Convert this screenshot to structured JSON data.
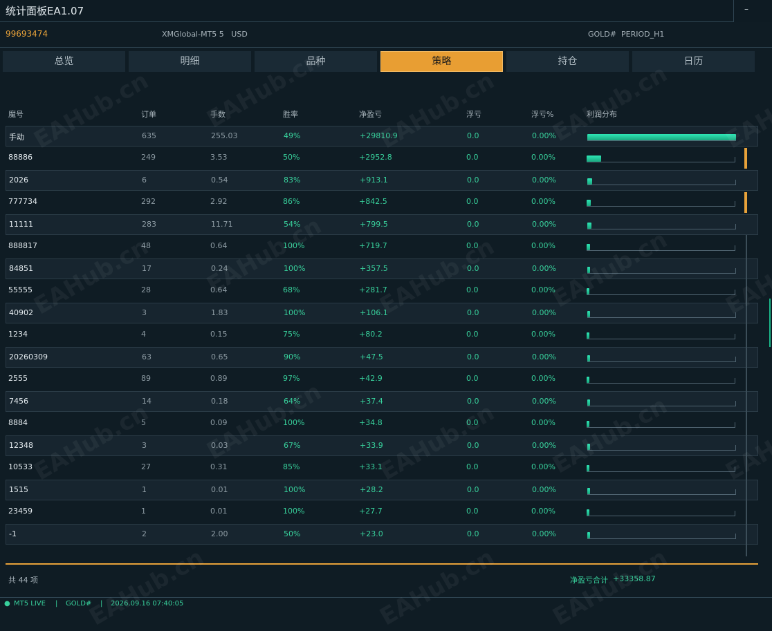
{
  "window": {
    "title": "统计面板EA1.07",
    "minimize_label": "–"
  },
  "info": {
    "account": "99693474",
    "server": "XMGlobal-MT5 5",
    "currency": "USD",
    "symbol": "GOLD#",
    "period": "PERIOD_H1"
  },
  "tabs": [
    {
      "label": "总览"
    },
    {
      "label": "明细"
    },
    {
      "label": "品种"
    },
    {
      "label": "策略",
      "active": true
    },
    {
      "label": "持仓"
    },
    {
      "label": "日历"
    }
  ],
  "table": {
    "columns": [
      "魔号",
      "订单",
      "手数",
      "胜率",
      "净盈亏",
      "浮亏",
      "浮亏%",
      "利润分布"
    ],
    "rows": [
      {
        "magic": "手动",
        "orders": "635",
        "lots": "255.03",
        "winrate": "49%",
        "net": "+29810.9",
        "float": "0.0",
        "float_pct": "0.00%",
        "share": 1.0,
        "accent": false
      },
      {
        "magic": "88886",
        "orders": "249",
        "lots": "3.53",
        "winrate": "50%",
        "net": "+2952.8",
        "float": "0.0",
        "float_pct": "0.00%",
        "share": 0.099,
        "accent": true
      },
      {
        "magic": "2026",
        "orders": "6",
        "lots": "0.54",
        "winrate": "83%",
        "net": "+913.1",
        "float": "0.0",
        "float_pct": "0.00%",
        "share": 0.031,
        "accent": false
      },
      {
        "magic": "777734",
        "orders": "292",
        "lots": "2.92",
        "winrate": "86%",
        "net": "+842.5",
        "float": "0.0",
        "float_pct": "0.00%",
        "share": 0.028,
        "accent": true
      },
      {
        "magic": "11111",
        "orders": "283",
        "lots": "11.71",
        "winrate": "54%",
        "net": "+799.5",
        "float": "0.0",
        "float_pct": "0.00%",
        "share": 0.027,
        "accent": false
      },
      {
        "magic": "888817",
        "orders": "48",
        "lots": "0.64",
        "winrate": "100%",
        "net": "+719.7",
        "float": "0.0",
        "float_pct": "0.00%",
        "share": 0.024,
        "accent": false
      },
      {
        "magic": "84851",
        "orders": "17",
        "lots": "0.24",
        "winrate": "100%",
        "net": "+357.5",
        "float": "0.0",
        "float_pct": "0.00%",
        "share": 0.012,
        "accent": false
      },
      {
        "magic": "55555",
        "orders": "28",
        "lots": "0.64",
        "winrate": "68%",
        "net": "+281.7",
        "float": "0.0",
        "float_pct": "0.00%",
        "share": 0.0095,
        "accent": false
      },
      {
        "magic": "40902",
        "orders": "3",
        "lots": "1.83",
        "winrate": "100%",
        "net": "+106.1",
        "float": "0.0",
        "float_pct": "0.00%",
        "share": 0.0036,
        "accent": false
      },
      {
        "magic": "1234",
        "orders": "4",
        "lots": "0.15",
        "winrate": "75%",
        "net": "+80.2",
        "float": "0.0",
        "float_pct": "0.00%",
        "share": 0.0027,
        "accent": false
      },
      {
        "magic": "20260309",
        "orders": "63",
        "lots": "0.65",
        "winrate": "90%",
        "net": "+47.5",
        "float": "0.0",
        "float_pct": "0.00%",
        "share": 0.0016,
        "accent": false
      },
      {
        "magic": "2555",
        "orders": "89",
        "lots": "0.89",
        "winrate": "97%",
        "net": "+42.9",
        "float": "0.0",
        "float_pct": "0.00%",
        "share": 0.0014,
        "accent": false
      },
      {
        "magic": "7456",
        "orders": "14",
        "lots": "0.18",
        "winrate": "64%",
        "net": "+37.4",
        "float": "0.0",
        "float_pct": "0.00%",
        "share": 0.0013,
        "accent": false
      },
      {
        "magic": "8884",
        "orders": "5",
        "lots": "0.09",
        "winrate": "100%",
        "net": "+34.8",
        "float": "0.0",
        "float_pct": "0.00%",
        "share": 0.0012,
        "accent": false
      },
      {
        "magic": "12348",
        "orders": "3",
        "lots": "0.03",
        "winrate": "67%",
        "net": "+33.9",
        "float": "0.0",
        "float_pct": "0.00%",
        "share": 0.0011,
        "accent": false
      },
      {
        "magic": "10533",
        "orders": "27",
        "lots": "0.31",
        "winrate": "85%",
        "net": "+33.1",
        "float": "0.0",
        "float_pct": "0.00%",
        "share": 0.0011,
        "accent": false
      },
      {
        "magic": "1515",
        "orders": "1",
        "lots": "0.01",
        "winrate": "100%",
        "net": "+28.2",
        "float": "0.0",
        "float_pct": "0.00%",
        "share": 0.0009,
        "accent": false
      },
      {
        "magic": "23459",
        "orders": "1",
        "lots": "0.01",
        "winrate": "100%",
        "net": "+27.7",
        "float": "0.0",
        "float_pct": "0.00%",
        "share": 0.0009,
        "accent": false
      },
      {
        "magic": "-1",
        "orders": "2",
        "lots": "2.00",
        "winrate": "50%",
        "net": "+23.0",
        "float": "0.0",
        "float_pct": "0.00%",
        "share": 0.0008,
        "accent": false
      }
    ]
  },
  "footer": {
    "count_label": "共 44 项",
    "net_label": "净盈亏合计",
    "net_value": "+33358.87"
  },
  "status": {
    "mode": "MT5 LIVE",
    "symbol": "GOLD#",
    "time": "2026.09.16 07:40:05",
    "separator": "|"
  },
  "watermark": "EAHub.cn",
  "colors": {
    "accent": "#e89e33",
    "positive": "#38d19c",
    "bar": "#2ee6b5",
    "background": "#0f1c24"
  }
}
